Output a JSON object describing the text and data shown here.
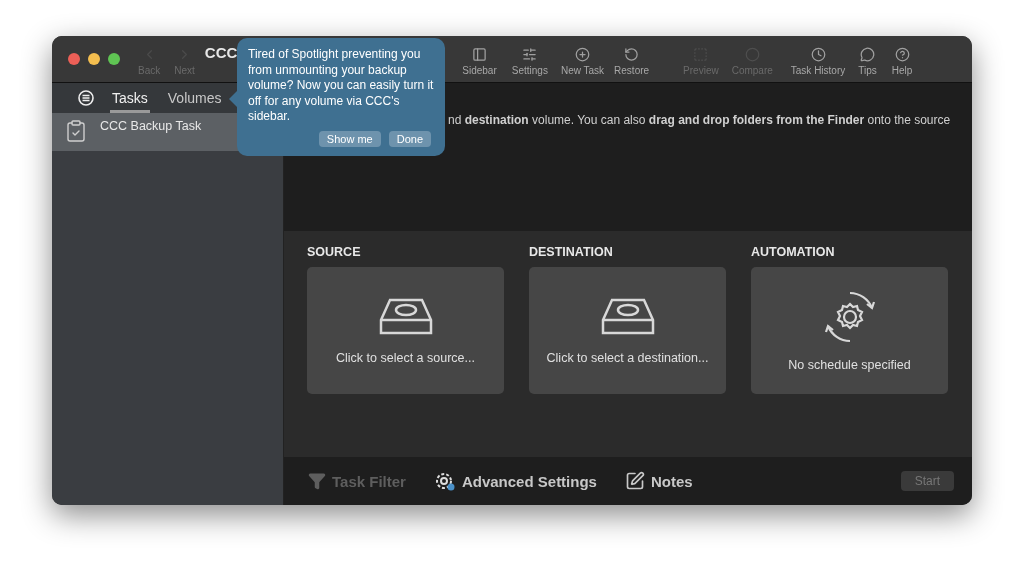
{
  "window": {
    "title": "CCC"
  },
  "toolbar": {
    "nav": [
      {
        "label": "Back",
        "disabled": true,
        "kind": "back"
      },
      {
        "label": "Next",
        "disabled": true,
        "kind": "next"
      }
    ],
    "items": [
      {
        "label": "Sidebar",
        "disabled": false,
        "kind": "sidebar"
      },
      {
        "label": "Settings",
        "disabled": false,
        "kind": "settings"
      },
      {
        "label": "New Task",
        "disabled": false,
        "kind": "new"
      },
      {
        "label": "Restore",
        "disabled": false,
        "kind": "restore"
      },
      {
        "label": "Preview",
        "disabled": true,
        "kind": "preview"
      },
      {
        "label": "Compare",
        "disabled": true,
        "kind": "compare"
      },
      {
        "label": "Task History",
        "disabled": false,
        "kind": "history"
      },
      {
        "label": "Tips",
        "disabled": false,
        "kind": "tips"
      },
      {
        "label": "Help",
        "disabled": false,
        "kind": "help"
      }
    ]
  },
  "sidebar": {
    "tabs": [
      {
        "label": "Tasks",
        "selected": true
      },
      {
        "label": "Volumes",
        "selected": false
      }
    ],
    "items": [
      {
        "label": "CCC Backup Task",
        "selected": true
      }
    ]
  },
  "popover": {
    "text": "Tired of Spotlight preventing you from unmounting your backup volume? Now you can easily turn it off for any volume via CCC's sidebar.",
    "buttons": [
      "Show me",
      "Done"
    ]
  },
  "main": {
    "instructions": "nd **destination** volume. You can also **drag and drop folders from the Finder** onto the source",
    "sections": [
      {
        "heading": "SOURCE",
        "label": "Click to select a source...",
        "kind": "drive"
      },
      {
        "heading": "DESTINATION",
        "label": "Click to select a destination...",
        "kind": "drive"
      },
      {
        "heading": "AUTOMATION",
        "label": "No schedule specified",
        "kind": "schedule"
      }
    ]
  },
  "footer": {
    "items": [
      {
        "label": "Task Filter",
        "disabled": true,
        "kind": "filter"
      },
      {
        "label": "Advanced Settings",
        "disabled": false,
        "kind": "advanced"
      },
      {
        "label": "Notes",
        "disabled": false,
        "kind": "notes"
      }
    ],
    "start": {
      "label": "Start",
      "disabled": true
    }
  }
}
